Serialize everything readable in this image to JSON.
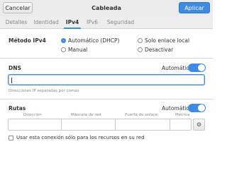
{
  "header": {
    "cancel_label": "Cancelar",
    "title": "Cableada",
    "apply_label": "Aplicar"
  },
  "tabs": [
    {
      "label": "Detalles"
    },
    {
      "label": "Identidad"
    },
    {
      "label": "IPv4",
      "active": true
    },
    {
      "label": "IPv6"
    },
    {
      "label": "Seguridad"
    }
  ],
  "ipv4_method": {
    "label": "Método IPv4",
    "options": [
      {
        "label": "Automático (DHCP)",
        "checked": true
      },
      {
        "label": "Solo enlace local",
        "checked": false
      },
      {
        "label": "Manual",
        "checked": false
      },
      {
        "label": "Desactivar",
        "checked": false
      }
    ]
  },
  "dns": {
    "label": "DNS",
    "auto_label": "Automático",
    "auto_enabled": true,
    "value": "",
    "hint": "Direcciones IP separadas por comas"
  },
  "routes": {
    "label": "Rutas",
    "auto_label": "Automático",
    "auto_enabled": true,
    "columns": [
      "Dirección",
      "Máscara de red",
      "Puerta de enlace",
      "Métrica"
    ],
    "row": [
      "",
      "",
      "",
      ""
    ]
  },
  "only_local_resources": {
    "label": "Usar esta conexión sólo para los recursos en su red",
    "checked": false
  },
  "colors": {
    "accent": "#3f8ae2",
    "header_bg": "#ebebeb"
  }
}
